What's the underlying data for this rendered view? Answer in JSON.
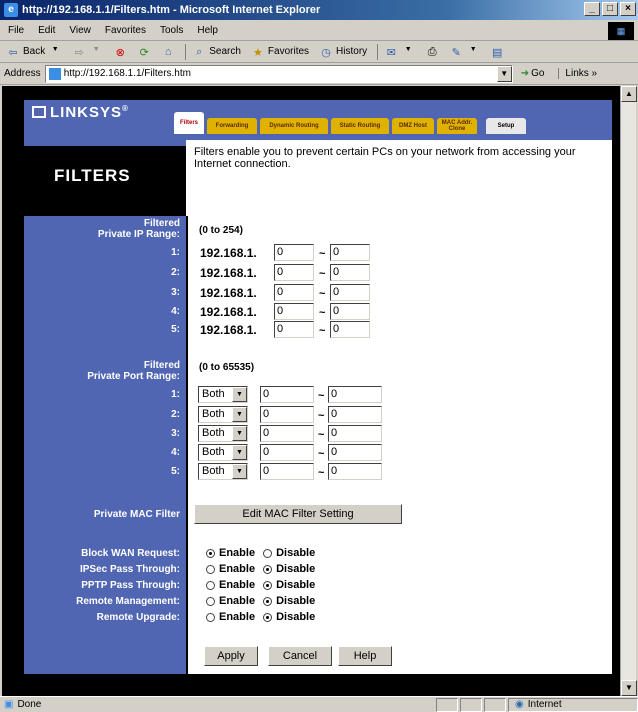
{
  "window": {
    "title": "http://192.168.1.1/Filters.htm - Microsoft Internet Explorer",
    "minimize": "_",
    "maximize": "□",
    "close": "×"
  },
  "menu": [
    "File",
    "Edit",
    "View",
    "Favorites",
    "Tools",
    "Help"
  ],
  "toolbar": {
    "back": "Back",
    "search": "Search",
    "favorites": "Favorites",
    "history": "History"
  },
  "address": {
    "label": "Address",
    "url": "http://192.168.1.1/Filters.htm",
    "go": "Go",
    "links": "Links »"
  },
  "status": {
    "text": "Done",
    "zone": "Internet"
  },
  "brand": {
    "logo": "LINKSYS",
    "logo_mark": "®"
  },
  "tabs": [
    {
      "label": "Filters",
      "state": "active"
    },
    {
      "label": "Forwarding",
      "state": "normal"
    },
    {
      "label": "Dynamic Routing",
      "state": "normal"
    },
    {
      "label": "Static Routing",
      "state": "normal"
    },
    {
      "label": "DMZ Host",
      "state": "normal"
    },
    {
      "label": "MAC Addr. Clone",
      "state": "normal"
    },
    {
      "label": "Setup",
      "state": "setup"
    }
  ],
  "page": {
    "heading": "FILTERS",
    "description": "Filters enable you to prevent certain PCs on your network from accessing your Internet connection."
  },
  "ip_range": {
    "label_line1": "Filtered",
    "label_line2": "Private IP Range:",
    "hint": "(0 to 254)",
    "prefix": "192.168.1.",
    "tilde": "~",
    "rows": [
      {
        "num": "1:",
        "from": "0",
        "to": "0"
      },
      {
        "num": "2:",
        "from": "0",
        "to": "0"
      },
      {
        "num": "3:",
        "from": "0",
        "to": "0"
      },
      {
        "num": "4:",
        "from": "0",
        "to": "0"
      },
      {
        "num": "5:",
        "from": "0",
        "to": "0"
      }
    ]
  },
  "port_range": {
    "label_line1": "Filtered",
    "label_line2": "Private Port Range:",
    "hint": "(0 to 65535)",
    "tilde": "~",
    "rows": [
      {
        "num": "1:",
        "protocol": "Both",
        "from": "0",
        "to": "0"
      },
      {
        "num": "2:",
        "protocol": "Both",
        "from": "0",
        "to": "0"
      },
      {
        "num": "3:",
        "protocol": "Both",
        "from": "0",
        "to": "0"
      },
      {
        "num": "4:",
        "protocol": "Both",
        "from": "0",
        "to": "0"
      },
      {
        "num": "5:",
        "protocol": "Both",
        "from": "0",
        "to": "0"
      }
    ]
  },
  "mac_filter": {
    "label": "Private MAC Filter",
    "button": "Edit MAC Filter Setting"
  },
  "options": {
    "enable_label": "Enable",
    "disable_label": "Disable",
    "rows": [
      {
        "label": "Block WAN Request:",
        "selected": "enable"
      },
      {
        "label": "IPSec Pass Through:",
        "selected": "disable"
      },
      {
        "label": "PPTP Pass Through:",
        "selected": "disable"
      },
      {
        "label": "Remote Management:",
        "selected": "disable"
      },
      {
        "label": "Remote Upgrade:",
        "selected": "disable"
      }
    ]
  },
  "actions": {
    "apply": "Apply",
    "cancel": "Cancel",
    "help": "Help"
  }
}
